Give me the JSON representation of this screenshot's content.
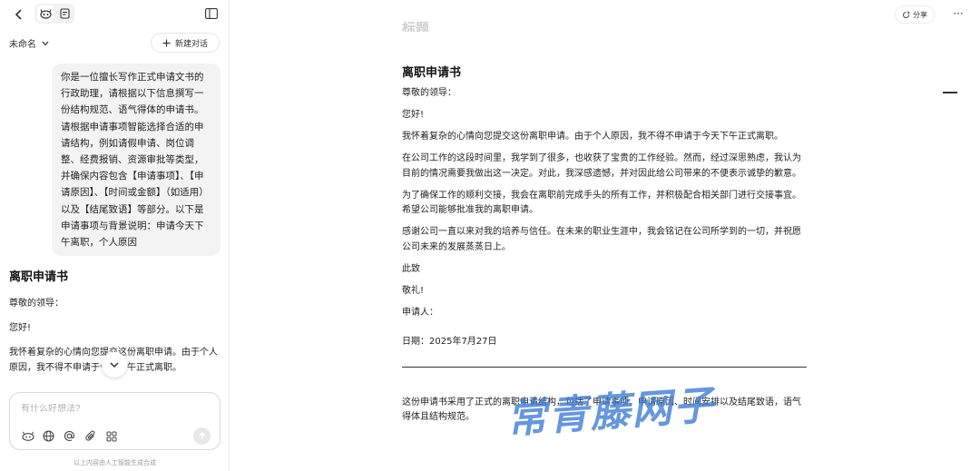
{
  "left": {
    "conversation_name": "未命名",
    "new_chat_label": "新建对话",
    "user_message": "你是一位擅长写作正式申请文书的行政助理，请根据以下信息撰写一份结构规范、语气得体的申请书。请根据申请事项智能选择合适的申请结构，例如请假申请、岗位调整、经费报销、资源审批等类型，并确保内容包含【申请事项】、【申请原因】、【时间或金额】（如适用）以及【结尾致语】等部分。以下是申请事项与背景说明：申请今天下午离职，个人原因",
    "reply": {
      "title": "离职申请书",
      "p1": "尊敬的领导：",
      "p2": "您好!",
      "p3": "我怀着复杂的心情向您提交这份离职申请。由于个人原因，我不得不申请于今天下午正式离职。"
    },
    "input_placeholder": "有什么好想法?",
    "footnote": "以上内容由人工智能生成合成"
  },
  "right": {
    "share_label": "分享",
    "more_label": "···",
    "ghost_title": "标题",
    "doc_title": "离职申请书",
    "paragraphs": [
      "尊敬的领导：",
      "您好!",
      "我怀着复杂的心情向您提交这份离职申请。由于个人原因，我不得不申请于今天下午正式离职。",
      "在公司工作的这段时间里，我学到了很多，也收获了宝贵的工作经验。然而，经过深思熟虑，我认为目前的情况需要我做出这一决定。对此，我深感遗憾，并对因此给公司带来的不便表示诚挚的歉意。",
      "为了确保工作的顺利交接，我会在离职前完成手头的所有工作，并积极配合相关部门进行交接事宜。希望公司能够批准我的离职申请。",
      "感谢公司一直以来对我的培养与信任。在未来的职业生涯中，我会铭记在公司所学到的一切，并祝愿公司未来的发展蒸蒸日上。",
      "此致",
      "敬礼!",
      "申请人：",
      "日期：2025年7月27日"
    ],
    "summary": "这份申请书采用了正式的离职申请结构，包括了申请事项、申请原因、时间安排以及结尾致语，语气得体且结构规范。"
  },
  "watermark": "常青藤网子",
  "colors": {
    "accent": "#3a7bd5",
    "bubble": "#f3f3f3"
  }
}
